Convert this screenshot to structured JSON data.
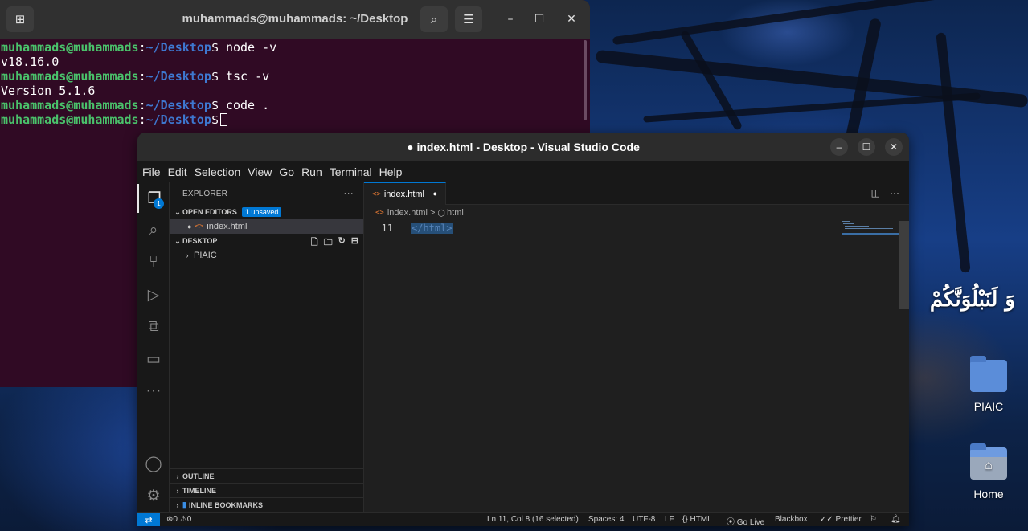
{
  "terminal": {
    "title": "muhammads@muhammads: ~/Desktop",
    "user_host": "muhammads@muhammads",
    "colon": ":",
    "path": "~/Desktop",
    "prompt_char": "$",
    "lines": [
      {
        "type": "cmd",
        "text": " node -v"
      },
      {
        "type": "out",
        "text": "v18.16.0"
      },
      {
        "type": "cmd",
        "text": " tsc -v"
      },
      {
        "type": "out",
        "text": "Version 5.1.6"
      },
      {
        "type": "cmd",
        "text": " code ."
      },
      {
        "type": "prompt",
        "text": " "
      }
    ]
  },
  "vscode": {
    "title": "● index.html - Desktop - Visual Studio Code",
    "menu": [
      "File",
      "Edit",
      "Selection",
      "View",
      "Go",
      "Run",
      "Terminal",
      "Help"
    ],
    "explorer": {
      "header": "EXPLORER",
      "more": "···",
      "open_editors": "OPEN EDITORS",
      "unsaved_badge": "1 unsaved",
      "open_file": "index.html",
      "desktop": "DESKTOP",
      "folder": "PIAIC",
      "outline": "OUTLINE",
      "timeline": "TIMELINE",
      "bookmarks": "INLINE BOOKMARKS"
    },
    "activity_badge": "1",
    "tab": {
      "label": "index.html",
      "modified": "●"
    },
    "breadcrumb": {
      "file": "index.html",
      "sep": ">",
      "node": "html"
    },
    "code": {
      "line_number": "11",
      "text": "</html>"
    },
    "status": {
      "errors": "0",
      "warnings": "0",
      "position": "Ln 11, Col 8 (16 selected)",
      "spaces": "Spaces: 4",
      "encoding": "UTF-8",
      "eol": "LF",
      "language": "HTML",
      "golive": "Go Live",
      "blackbox": "Blackbox",
      "prettier": "Prettier"
    }
  },
  "desktop": {
    "quote": "وَ لَنَبْلُوَنَّكُمْ",
    "icons": [
      {
        "label": "PIAIC",
        "icon": "folder-icon"
      },
      {
        "label": "Home",
        "icon": "home-folder-icon"
      }
    ]
  }
}
